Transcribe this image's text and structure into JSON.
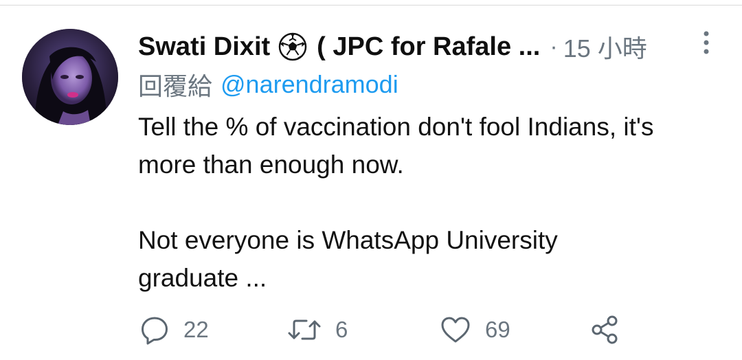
{
  "tweet": {
    "author_name": "Swati Dixit",
    "author_name_suffix": "( JPC for Rafale ...",
    "separator": "·",
    "timestamp": "15 小時",
    "reply_prefix": "回覆給",
    "reply_handle": "@narendramodi",
    "text_paragraph_1_line_1": "Tell the % of vaccination don't fool Indians, it's",
    "text_paragraph_1_line_2": "more than enough now.",
    "text_paragraph_2_line_1": "Not everyone is WhatsApp University",
    "text_paragraph_2_line_2": "graduate ..."
  },
  "actions": {
    "reply_count": "22",
    "retweet_count": "6",
    "like_count": "69"
  },
  "icons": {
    "author_badge": "soccer-ball-icon",
    "more": "more-vertical-icon",
    "reply": "reply-bubble-icon",
    "retweet": "retweet-icon",
    "like": "heart-icon",
    "share": "share-icon"
  },
  "colors": {
    "link": "#1d9bf0",
    "muted": "#6b7680",
    "text": "#111111"
  }
}
